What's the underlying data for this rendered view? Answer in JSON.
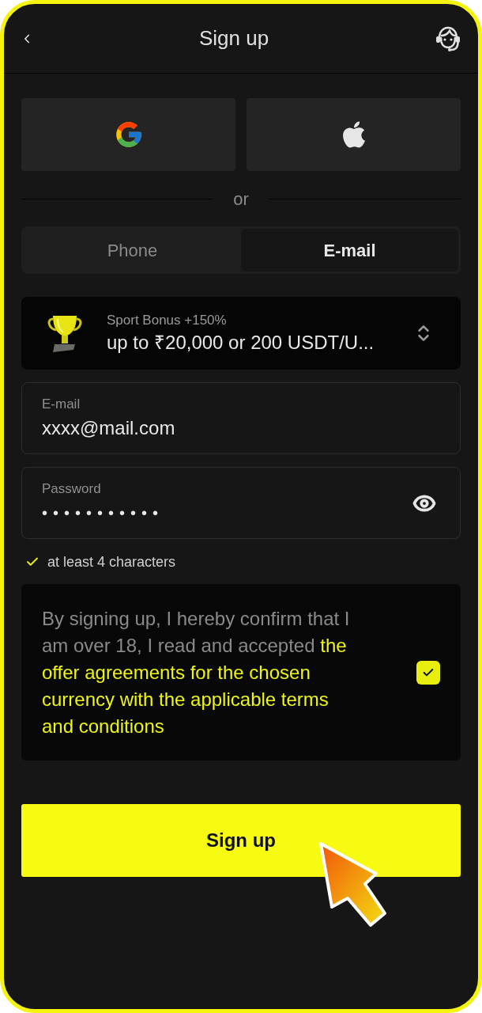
{
  "header": {
    "title": "Sign up"
  },
  "social_buttons": [
    {
      "kind": "google"
    },
    {
      "kind": "apple"
    }
  ],
  "divider": {
    "label": "or"
  },
  "tabs": [
    {
      "label": "Phone",
      "selected": false
    },
    {
      "label": "E-mail",
      "selected": true
    }
  ],
  "bonus_select": {
    "title": "Sport Bonus +150%",
    "value": "up to ₹20,000 or 200 USDT/U..."
  },
  "email_field": {
    "label": "E-mail",
    "value": "xxxx@mail.com"
  },
  "password_field": {
    "label": "Password",
    "value": "•••••••••••"
  },
  "password_hint": {
    "text": "at least 4 characters",
    "met": true
  },
  "consent": {
    "text": "By signing up, I hereby confirm that I am over 18, I read and accepted ",
    "link": "the offer agreements for the chosen currency with the applicable terms and conditions",
    "checked": true
  },
  "submit_button": {
    "label": "Sign up"
  }
}
